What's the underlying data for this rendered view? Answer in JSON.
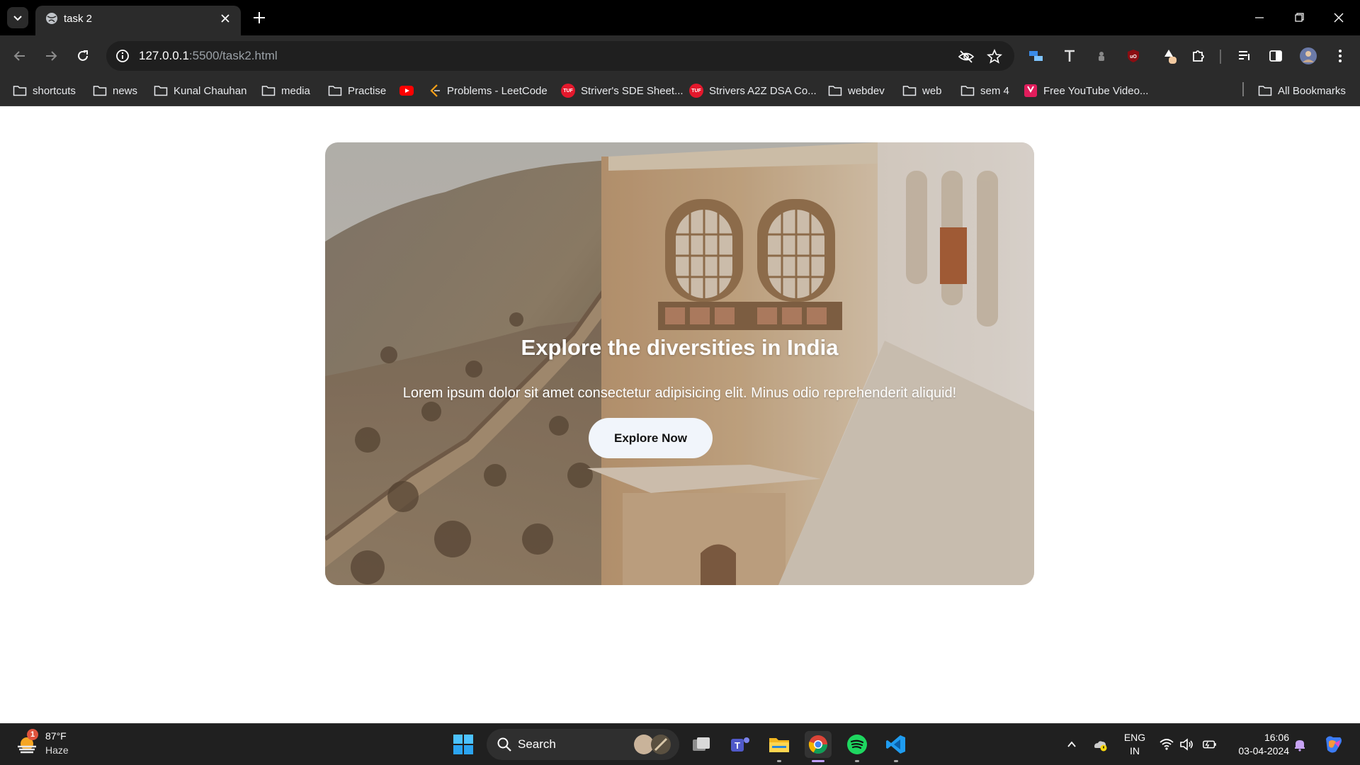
{
  "browser": {
    "tab_title": "task 2",
    "url_host": "127.0.0.1",
    "url_path": ":5500/task2.html"
  },
  "bookmarks": [
    {
      "label": "shortcuts",
      "icon": "folder-icon"
    },
    {
      "label": "news",
      "icon": "folder-icon"
    },
    {
      "label": "Kunal Chauhan",
      "icon": "folder-icon"
    },
    {
      "label": "media",
      "icon": "folder-icon"
    },
    {
      "label": "Practise",
      "icon": "folder-icon"
    },
    {
      "label": "",
      "icon": "youtube-icon"
    },
    {
      "label": "Problems - LeetCode",
      "icon": "leetcode-icon"
    },
    {
      "label": "Striver's SDE Sheet...",
      "icon": "tuf-icon",
      "badge": "TUF"
    },
    {
      "label": "Strivers A2Z DSA Co...",
      "icon": "tuf-icon",
      "badge": "TUF"
    },
    {
      "label": "webdev",
      "icon": "folder-icon"
    },
    {
      "label": "web",
      "icon": "folder-icon"
    },
    {
      "label": "sem 4",
      "icon": "folder-icon"
    },
    {
      "label": "Free YouTube Video...",
      "icon": "video-icon"
    }
  ],
  "all_bookmarks_label": "All Bookmarks",
  "hero": {
    "title": "Explore the diversities in India",
    "text": "Lorem ipsum dolor sit amet consectetur adipisicing elit. Minus odio reprehenderit aliquid!",
    "button_label": "Explore Now"
  },
  "taskbar": {
    "weather_temp": "87°F",
    "weather_cond": "Haze",
    "weather_badge": "1",
    "search_label": "Search",
    "lang_line1": "ENG",
    "lang_line2": "IN",
    "time": "16:06",
    "date": "03-04-2024"
  },
  "colors": {
    "titlebar": "#000000",
    "toolbar": "#2b2b2b",
    "omnibox": "#1f1f1f",
    "taskbar": "#202020",
    "button_bg": "#f1f5fb"
  }
}
